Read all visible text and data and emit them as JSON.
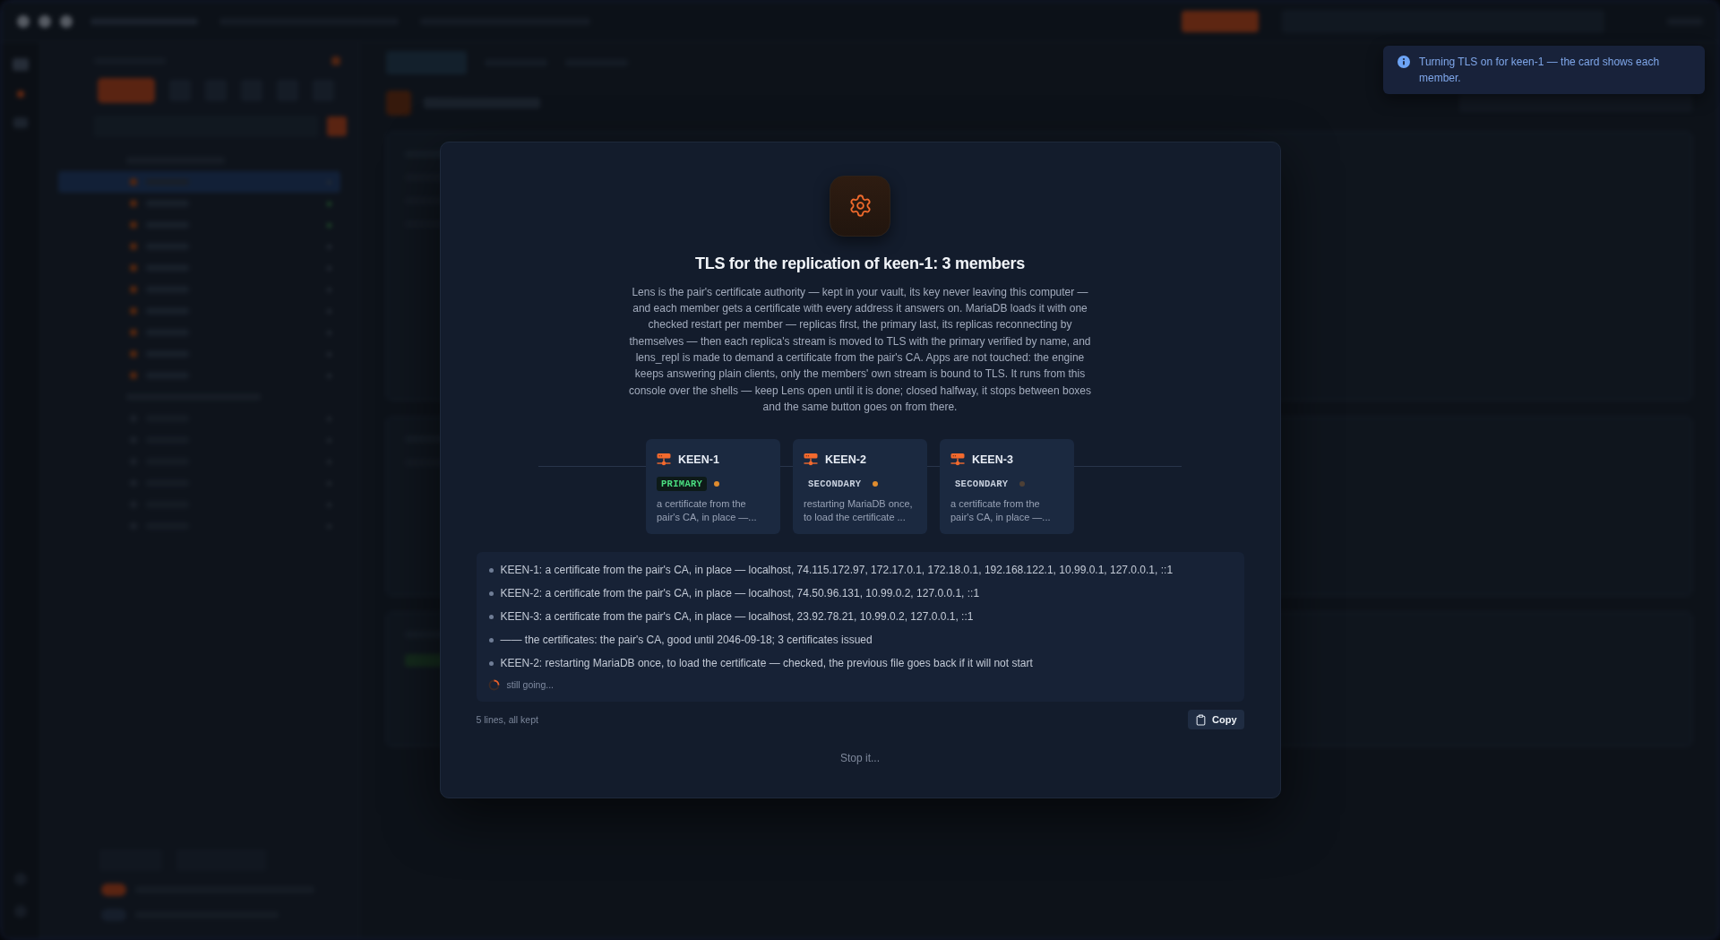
{
  "toast": {
    "text": "Turning TLS on for keen-1 — the card shows each member."
  },
  "dialog": {
    "title": "TLS for the replication of keen-1: 3 members",
    "description": "Lens is the pair's certificate authority — kept in your vault, its key never leaving this computer — and each member gets a certificate with every address it answers on. MariaDB loads it with one checked restart per member — replicas first, the primary last, its replicas reconnecting by themselves — then each replica's stream is moved to TLS with the primary verified by name, and lens_repl is made to demand a certificate from the pair's CA. Apps are not touched: the engine keeps answering plain clients, only the members' own stream is bound to TLS. It runs from this console over the shells — keep Lens open until it is done; closed halfway, it stops between boxes and the same button goes on from there.",
    "members": [
      {
        "name": "KEEN-1",
        "badge": {
          "kind": "primary",
          "text": "PRIMARY"
        },
        "color": "#e08c2e",
        "status": "a certificate from the pair's CA, in place —..."
      },
      {
        "name": "KEEN-2",
        "badge": {
          "kind": "secondary",
          "text": "SECONDARY"
        },
        "color": "#e08c2e",
        "status": "restarting MariaDB once, to load the certificate ..."
      },
      {
        "name": "KEEN-3",
        "badge": {
          "kind": "secondary",
          "text": "SECONDARY"
        },
        "color": "#4d4036",
        "status": "a certificate from the pair's CA, in place —..."
      }
    ],
    "log": {
      "lines": [
        "KEEN-1: a certificate from the pair's CA, in place — localhost, 74.115.172.97, 172.17.0.1, 172.18.0.1, 192.168.122.1, 10.99.0.1, 127.0.0.1, ::1",
        "KEEN-2: a certificate from the pair's CA, in place — localhost, 74.50.96.131, 10.99.0.2, 127.0.0.1, ::1",
        "KEEN-3: a certificate from the pair's CA, in place — localhost, 23.92.78.21, 10.99.0.2, 127.0.0.1, ::1",
        "—— the certificates: the pair's CA, good until 2046-09-18; 3 certificates issued",
        "KEEN-2: restarting MariaDB once, to load the certificate — checked, the previous file goes back if it will not start"
      ],
      "progress": "still going...",
      "summary": "5 lines, all kept",
      "copy_button": "Copy"
    },
    "stop_button": "Stop it..."
  }
}
